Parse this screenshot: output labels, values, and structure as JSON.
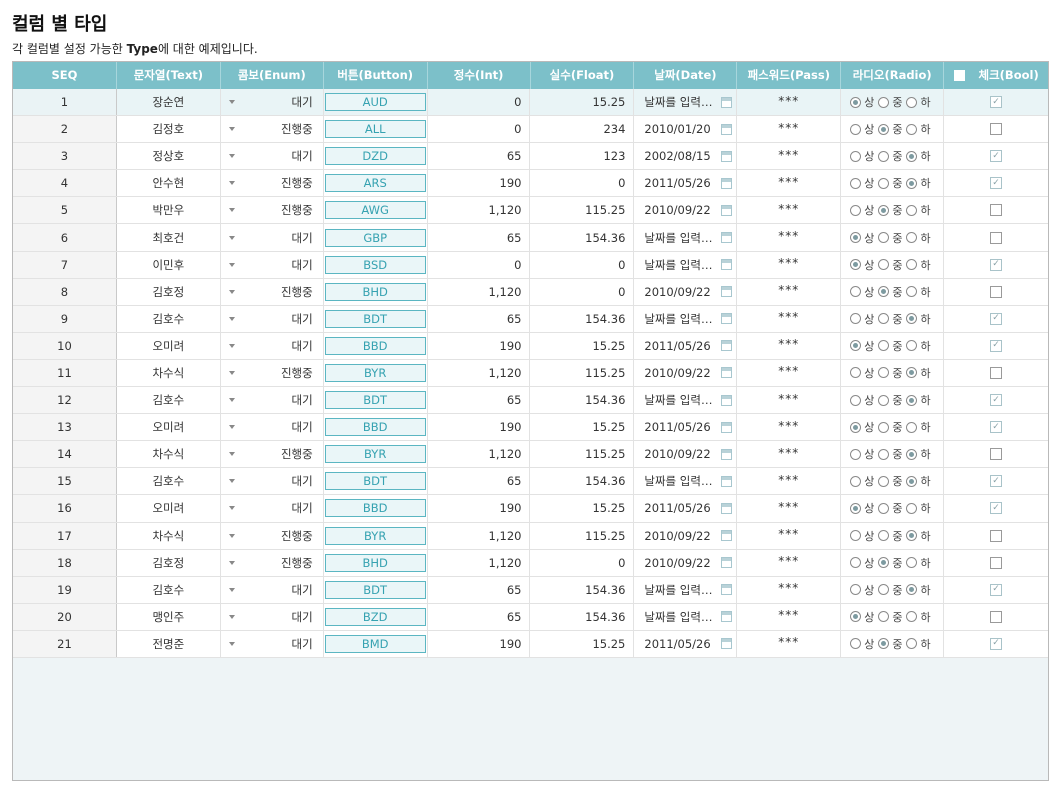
{
  "page": {
    "title": "컬럼 별 타입",
    "desc_prefix": "각 컬럼별 설정 가능한 ",
    "desc_bold": "Type",
    "desc_suffix": "에 대한 예제입니다."
  },
  "columns": [
    "SEQ",
    "문자열(Text)",
    "콤보(Enum)",
    "버튼(Button)",
    "정수(Int)",
    "실수(Float)",
    "날짜(Date)",
    "패스워드(Pass)",
    "라디오(Radio)",
    "체크(Bool)"
  ],
  "radio_options": [
    "상",
    "중",
    "하"
  ],
  "selected_row": 0,
  "rows": [
    {
      "seq": "1",
      "text": "장순연",
      "enum": "대기",
      "button": "AUD",
      "int": "0",
      "float": "15.25",
      "date": "날짜를 입력…",
      "pass": "***",
      "radio": 0,
      "check": true
    },
    {
      "seq": "2",
      "text": "김정호",
      "enum": "진행중",
      "button": "ALL",
      "int": "0",
      "float": "234",
      "date": "2010/01/20",
      "pass": "***",
      "radio": 1,
      "check": false
    },
    {
      "seq": "3",
      "text": "정상호",
      "enum": "대기",
      "button": "DZD",
      "int": "65",
      "float": "123",
      "date": "2002/08/15",
      "pass": "***",
      "radio": 2,
      "check": true
    },
    {
      "seq": "4",
      "text": "안수현",
      "enum": "진행중",
      "button": "ARS",
      "int": "190",
      "float": "0",
      "date": "2011/05/26",
      "pass": "***",
      "radio": 2,
      "check": true
    },
    {
      "seq": "5",
      "text": "박만우",
      "enum": "진행중",
      "button": "AWG",
      "int": "1,120",
      "float": "115.25",
      "date": "2010/09/22",
      "pass": "***",
      "radio": 1,
      "check": false
    },
    {
      "seq": "6",
      "text": "최호건",
      "enum": "대기",
      "button": "GBP",
      "int": "65",
      "float": "154.36",
      "date": "날짜를 입력…",
      "pass": "***",
      "radio": 0,
      "check": false
    },
    {
      "seq": "7",
      "text": "이민후",
      "enum": "대기",
      "button": "BSD",
      "int": "0",
      "float": "0",
      "date": "날짜를 입력…",
      "pass": "***",
      "radio": 0,
      "check": true
    },
    {
      "seq": "8",
      "text": "김호정",
      "enum": "진행중",
      "button": "BHD",
      "int": "1,120",
      "float": "0",
      "date": "2010/09/22",
      "pass": "***",
      "radio": 1,
      "check": false
    },
    {
      "seq": "9",
      "text": "김호수",
      "enum": "대기",
      "button": "BDT",
      "int": "65",
      "float": "154.36",
      "date": "날짜를 입력…",
      "pass": "***",
      "radio": 2,
      "check": true
    },
    {
      "seq": "10",
      "text": "오미려",
      "enum": "대기",
      "button": "BBD",
      "int": "190",
      "float": "15.25",
      "date": "2011/05/26",
      "pass": "***",
      "radio": 0,
      "check": true
    },
    {
      "seq": "11",
      "text": "차수식",
      "enum": "진행중",
      "button": "BYR",
      "int": "1,120",
      "float": "115.25",
      "date": "2010/09/22",
      "pass": "***",
      "radio": 2,
      "check": false
    },
    {
      "seq": "12",
      "text": "김호수",
      "enum": "대기",
      "button": "BDT",
      "int": "65",
      "float": "154.36",
      "date": "날짜를 입력…",
      "pass": "***",
      "radio": 2,
      "check": true
    },
    {
      "seq": "13",
      "text": "오미려",
      "enum": "대기",
      "button": "BBD",
      "int": "190",
      "float": "15.25",
      "date": "2011/05/26",
      "pass": "***",
      "radio": 0,
      "check": true
    },
    {
      "seq": "14",
      "text": "차수식",
      "enum": "진행중",
      "button": "BYR",
      "int": "1,120",
      "float": "115.25",
      "date": "2010/09/22",
      "pass": "***",
      "radio": 2,
      "check": false
    },
    {
      "seq": "15",
      "text": "김호수",
      "enum": "대기",
      "button": "BDT",
      "int": "65",
      "float": "154.36",
      "date": "날짜를 입력…",
      "pass": "***",
      "radio": 2,
      "check": true
    },
    {
      "seq": "16",
      "text": "오미려",
      "enum": "대기",
      "button": "BBD",
      "int": "190",
      "float": "15.25",
      "date": "2011/05/26",
      "pass": "***",
      "radio": 0,
      "check": true
    },
    {
      "seq": "17",
      "text": "차수식",
      "enum": "진행중",
      "button": "BYR",
      "int": "1,120",
      "float": "115.25",
      "date": "2010/09/22",
      "pass": "***",
      "radio": 2,
      "check": false
    },
    {
      "seq": "18",
      "text": "김호정",
      "enum": "진행중",
      "button": "BHD",
      "int": "1,120",
      "float": "0",
      "date": "2010/09/22",
      "pass": "***",
      "radio": 1,
      "check": false
    },
    {
      "seq": "19",
      "text": "김호수",
      "enum": "대기",
      "button": "BDT",
      "int": "65",
      "float": "154.36",
      "date": "날짜를 입력…",
      "pass": "***",
      "radio": 2,
      "check": true
    },
    {
      "seq": "20",
      "text": "맹인주",
      "enum": "대기",
      "button": "BZD",
      "int": "65",
      "float": "154.36",
      "date": "날짜를 입력…",
      "pass": "***",
      "radio": 0,
      "check": false
    },
    {
      "seq": "21",
      "text": "전명준",
      "enum": "대기",
      "button": "BMD",
      "int": "190",
      "float": "15.25",
      "date": "2011/05/26",
      "pass": "***",
      "radio": 1,
      "check": true
    }
  ],
  "colors": {
    "header_bg": "#7cc0c9",
    "button_border": "#5bb6c2",
    "button_text": "#36a2b1",
    "selected_row_bg": "#e9f4f6"
  }
}
